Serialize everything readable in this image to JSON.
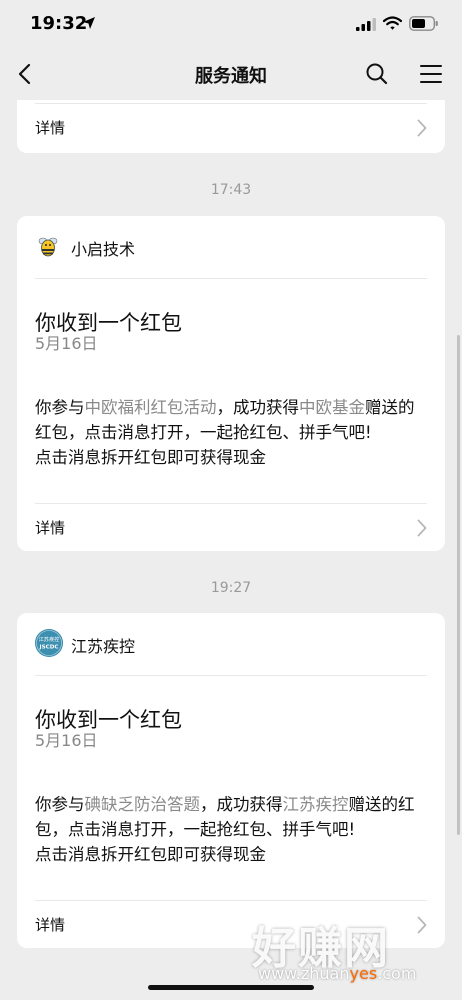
{
  "status_bar": {
    "time": "19:32",
    "icons": [
      "location-arrow-icon",
      "signal-icon",
      "wifi-icon",
      "battery-icon"
    ]
  },
  "nav": {
    "title": "服务通知",
    "icons": [
      "back-icon",
      "search-icon",
      "menu-icon"
    ]
  },
  "top_card": {
    "detail_label": "详情"
  },
  "messages": [
    {
      "timestamp": "17:43",
      "sender": "小启技术",
      "avatar_icon": "bee-icon",
      "title": "你收到一个红包",
      "date": "5月16日",
      "body_prefix": "你参与",
      "activity_link": "中欧福利红包活动",
      "body_mid": "，成功获得",
      "fund_link": "中欧基金",
      "body_suffix": "赠送的红包，点击消息打开，一起抢红包、拼手气吧!",
      "body_line2": "点击消息拆开红包即可获得现金",
      "detail_label": "详情"
    },
    {
      "timestamp": "19:27",
      "sender": "江苏疾控",
      "avatar_icon": "jscdc-logo",
      "avatar_text_top": "江苏疾控",
      "avatar_text_bottom": "JSCDC",
      "title": "你收到一个红包",
      "date": "5月16日",
      "body_prefix": "你参与",
      "activity_link": "碘缺乏防治答题",
      "body_mid": "，成功获得",
      "fund_link": "江苏疾控",
      "body_suffix": "赠送的红包，点击消息打开，一起抢红包、拼手气吧!",
      "body_line2": "点击消息拆开红包即可获得现金",
      "detail_label": "详情"
    }
  ],
  "watermark": {
    "main_text": "好赚网",
    "url_prefix": "www.zhuan",
    "url_accent": "yes",
    "url_suffix": ".com"
  },
  "colors": {
    "background": "#ededed",
    "card": "#ffffff",
    "link": "#8a8a8a",
    "watermark_accent": "#ff6a00"
  }
}
